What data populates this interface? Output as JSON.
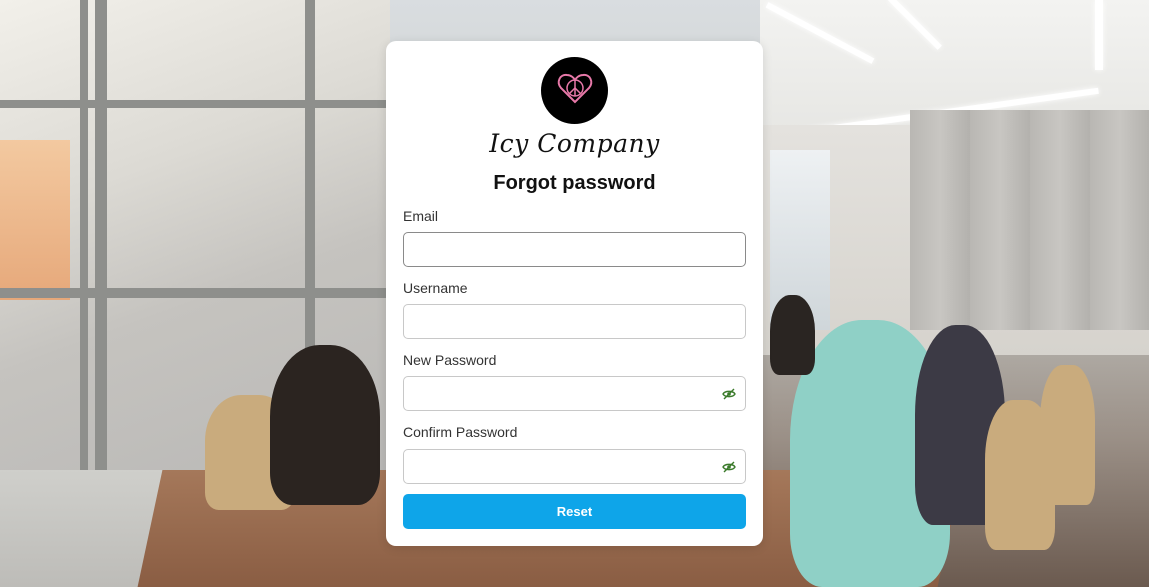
{
  "brand": {
    "company_name": "Icy Company",
    "logo_icon": "heart-peace-icon",
    "logo_accent": "#e879a9"
  },
  "form": {
    "title": "Forgot password",
    "fields": [
      {
        "label": "Email",
        "value": "",
        "type": "email"
      },
      {
        "label": "Username",
        "value": "",
        "type": "text"
      },
      {
        "label": "New Password",
        "value": "",
        "type": "password",
        "icon": "eye-slash-icon"
      },
      {
        "label": "Confirm Password",
        "value": "",
        "type": "password",
        "icon": "eye-slash-icon"
      }
    ],
    "submit_label": "Reset"
  },
  "colors": {
    "button": "#0ea5e9",
    "eye_icon": "#3a7a2a",
    "card": "#ffffff"
  }
}
